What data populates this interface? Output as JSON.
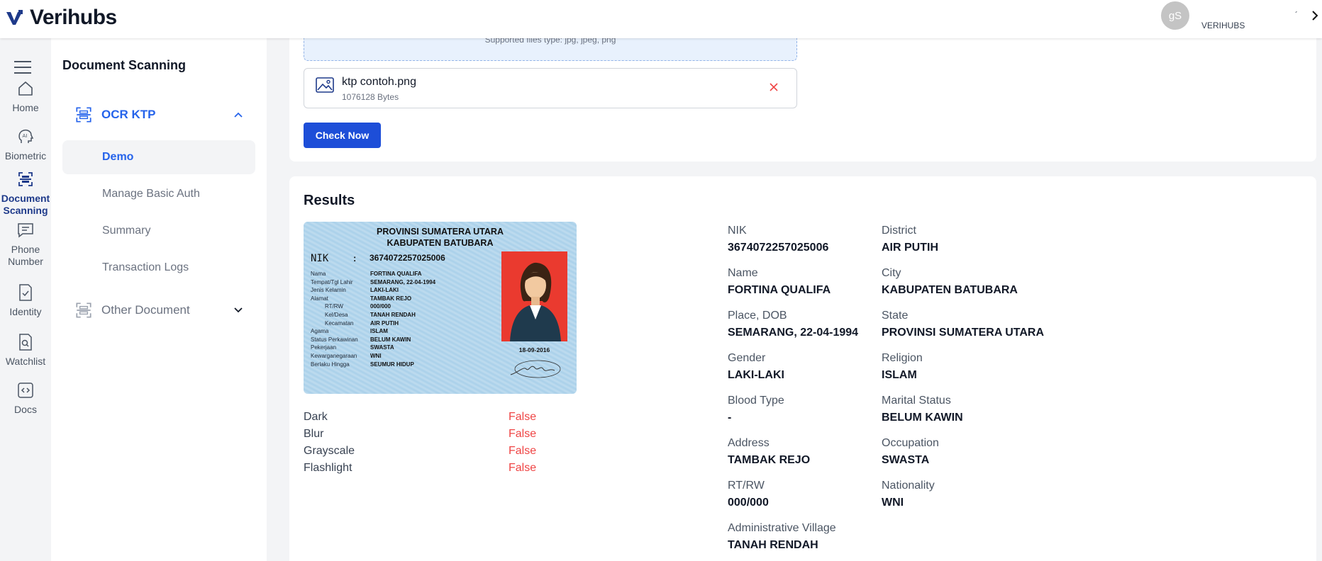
{
  "header": {
    "brand": "Verihubs",
    "avatar_initials": "gS",
    "user_name": "VERIHUBS",
    "tick_glyph": "´"
  },
  "rail": {
    "items": [
      {
        "label": "Home",
        "icon": "home-icon"
      },
      {
        "label": "Biometric",
        "icon": "ai-face-icon"
      },
      {
        "label": "Document\nScanning",
        "icon": "document-scan-icon",
        "active": true
      },
      {
        "label": "Phone\nNumber",
        "icon": "chat-icon"
      },
      {
        "label": "Identity",
        "icon": "identity-check-icon"
      },
      {
        "label": "Watchlist",
        "icon": "watchlist-search-icon"
      },
      {
        "label": "Docs",
        "icon": "code-icon"
      }
    ]
  },
  "subnav": {
    "title": "Document Scanning",
    "group_ocr": "OCR KTP",
    "items": [
      "Demo",
      "Manage Basic Auth",
      "Summary",
      "Transaction Logs"
    ],
    "group_other": "Other Document"
  },
  "upload": {
    "supported": "Supported files type: jpg, jpeg, png",
    "file_name": "ktp contoh.png",
    "file_size": "1076128 Bytes",
    "check_button": "Check Now"
  },
  "results": {
    "title": "Results",
    "ktp_card": {
      "province": "PROVINSI SUMATERA UTARA",
      "regency": "KABUPATEN BATUBARA",
      "nik_label": "NIK",
      "nik_colon": ":",
      "nik_value": "3674072257025006",
      "rows": [
        {
          "k": "Nama",
          "v": "FORTINA QUALIFA"
        },
        {
          "k": "Tempat/Tgl Lahir",
          "v": "SEMARANG, 22-04-1994"
        },
        {
          "k": "Jenis Kelamin",
          "v": "LAKI-LAKI"
        },
        {
          "k": "Alamat",
          "v": "TAMBAK REJO"
        },
        {
          "k": "RT/RW",
          "v": "000/000"
        },
        {
          "k": "Kel/Desa",
          "v": "TANAH RENDAH"
        },
        {
          "k": "Kecamatan",
          "v": "AIR PUTIH"
        },
        {
          "k": "Agama",
          "v": "ISLAM"
        },
        {
          "k": "Status Perkawinan",
          "v": "BELUM KAWIN"
        },
        {
          "k": "Pekerjaan",
          "v": "SWASTA"
        },
        {
          "k": "Kewarganegaraan",
          "v": "WNI"
        },
        {
          "k": "Berlaku Hingga",
          "v": "SEUMUR HIDUP"
        }
      ],
      "issue_date": "18-09-2016"
    },
    "quality": [
      {
        "label": "Dark",
        "value": "False"
      },
      {
        "label": "Blur",
        "value": "False"
      },
      {
        "label": "Grayscale",
        "value": "False"
      },
      {
        "label": "Flashlight",
        "value": "False"
      }
    ],
    "fields_left": [
      {
        "label": "NIK",
        "value": "3674072257025006"
      },
      {
        "label": "Name",
        "value": "FORTINA QUALIFA"
      },
      {
        "label": "Place, DOB",
        "value": "SEMARANG, 22-04-1994"
      },
      {
        "label": "Gender",
        "value": "LAKI-LAKI"
      },
      {
        "label": "Blood Type",
        "value": "-"
      },
      {
        "label": "Address",
        "value": "TAMBAK REJO"
      },
      {
        "label": "RT/RW",
        "value": "000/000"
      },
      {
        "label": "Administrative Village",
        "value": "TANAH RENDAH"
      }
    ],
    "fields_right": [
      {
        "label": "District",
        "value": "AIR PUTIH"
      },
      {
        "label": "City",
        "value": "KABUPATEN BATUBARA"
      },
      {
        "label": "State",
        "value": "PROVINSI SUMATERA UTARA"
      },
      {
        "label": "Religion",
        "value": "ISLAM"
      },
      {
        "label": "Marital Status",
        "value": "BELUM KAWIN"
      },
      {
        "label": "Occupation",
        "value": "SWASTA"
      },
      {
        "label": "Nationality",
        "value": "WNI"
      }
    ]
  },
  "colors": {
    "primary": "#1d4ed8",
    "accent": "#2563eb",
    "false_red": "#ef4444"
  }
}
